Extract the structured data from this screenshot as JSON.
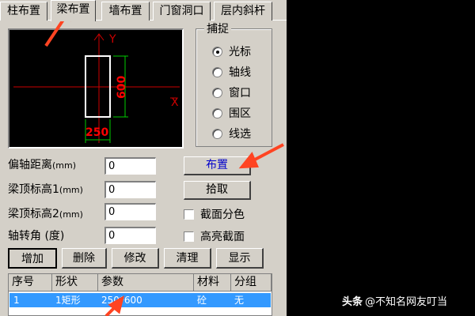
{
  "tabs": [
    "柱布置",
    "梁布置",
    "墙布置",
    "门窗洞口",
    "层内斜杆"
  ],
  "preview": {
    "axis_y": "Y",
    "axis_x": "X",
    "dim_height": "600",
    "dim_width": "250"
  },
  "snap": {
    "title": "捕捉",
    "options": [
      "光标",
      "轴线",
      "窗口",
      "围区",
      "线选"
    ],
    "selected": "光标"
  },
  "fields": [
    {
      "label": "偏轴距离",
      "unit": "(mm)",
      "value": "0"
    },
    {
      "label": "梁顶标高1",
      "unit": "(mm)",
      "value": "0"
    },
    {
      "label": "梁顶标高2",
      "unit": "(mm)",
      "value": "0"
    },
    {
      "label": "轴转角 (度)",
      "unit": "",
      "value": "0"
    }
  ],
  "buttons": {
    "place": "布置",
    "pick": "拾取"
  },
  "checkboxes": [
    "截面分色",
    "高亮截面"
  ],
  "toolbar": [
    "增加",
    "删除",
    "修改",
    "清理",
    "显示"
  ],
  "table": {
    "headers": [
      "序号",
      "形状",
      "参数",
      "材料",
      "分组"
    ],
    "rows": [
      [
        "1",
        "1矩形",
        "250*600",
        "砼",
        "无"
      ]
    ]
  },
  "watermark": {
    "brand": "头条",
    "author": "@不知名网友叮当"
  },
  "colors": {
    "panel": "#d4d0c8",
    "selection": "#3399ff",
    "preview_bg": "#000000",
    "beam": "#ffffff",
    "dimension": "#00cc00",
    "dimension_text": "#ff0000",
    "axis": "#cc0000",
    "annotation_arrow": "#ff4422"
  }
}
